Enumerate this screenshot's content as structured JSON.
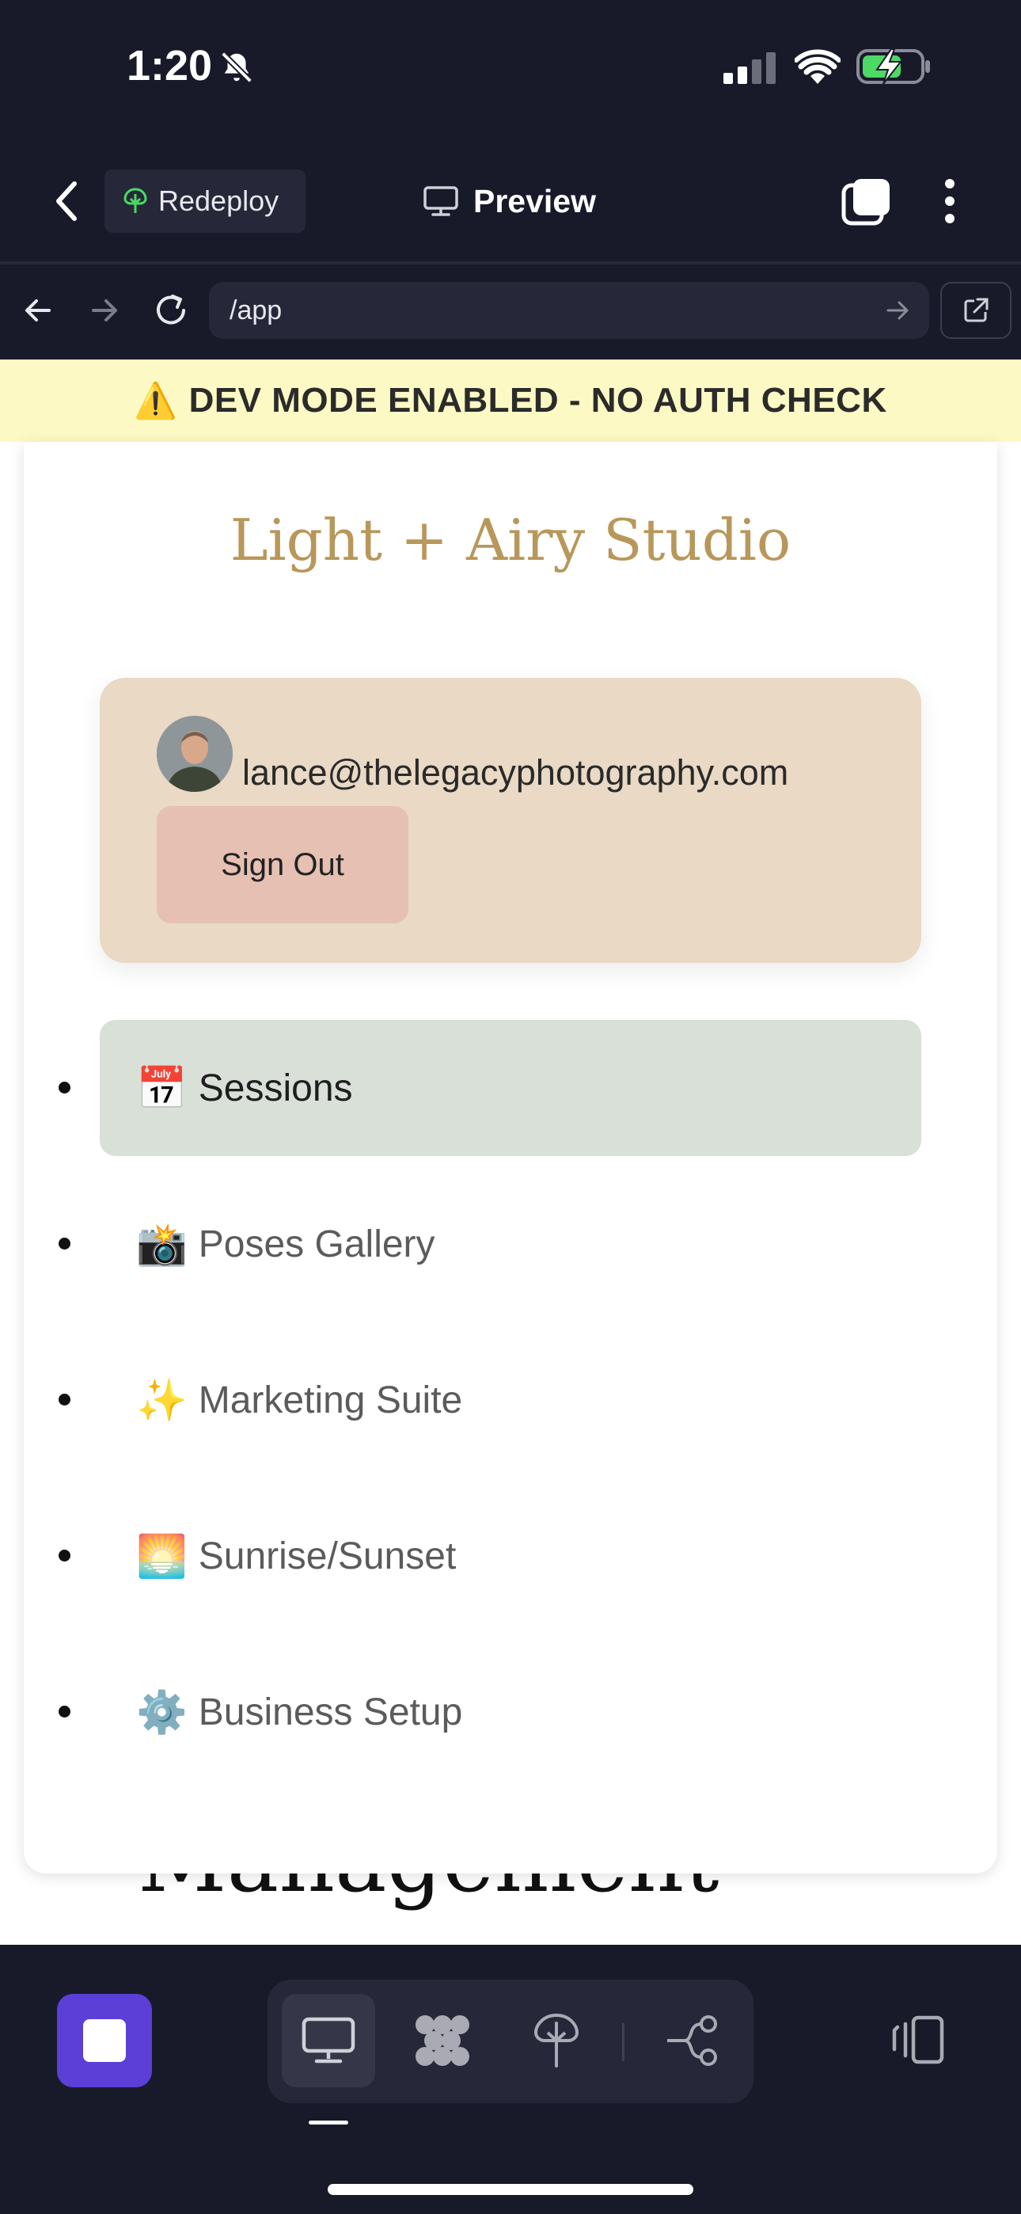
{
  "status_bar": {
    "time": "1:20"
  },
  "app_bar": {
    "redeploy_label": "Redeploy",
    "preview_label": "Preview"
  },
  "browser": {
    "url": "/app"
  },
  "dev_banner": {
    "icon": "⚠️",
    "text": "DEV MODE ENABLED - NO AUTH CHECK"
  },
  "page": {
    "studio_title": "Light + Airy Studio",
    "user": {
      "email": "lance@thelegacyphotography.com",
      "sign_out_label": "Sign Out"
    },
    "nav": [
      {
        "emoji": "📅",
        "label": "Sessions",
        "active": true
      },
      {
        "emoji": "📸",
        "label": "Poses Gallery",
        "active": false
      },
      {
        "emoji": "✨",
        "label": "Marketing Suite",
        "active": false
      },
      {
        "emoji": "🌅",
        "label": "Sunrise/Sunset",
        "active": false
      },
      {
        "emoji": "⚙️",
        "label": "Business Setup",
        "active": false
      }
    ],
    "behind_heading": "Management"
  },
  "colors": {
    "accent_gold": "#b8975a",
    "user_card": "#e9d9c5",
    "sign_out": "#e5c0b3",
    "nav_active": "#d8e0d8",
    "dev_banner": "#fdf9c4",
    "stop_button": "#5b3fd6"
  }
}
